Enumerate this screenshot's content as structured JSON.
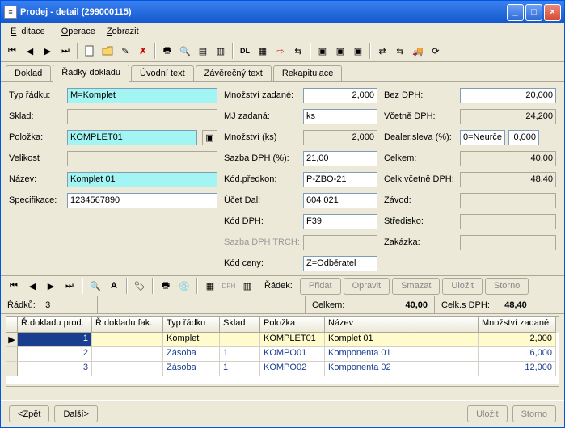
{
  "title": "Prodej - detail (299000115)",
  "menu": {
    "edit": "Editace",
    "oper": "Operace",
    "view": "Zobrazit"
  },
  "tabs": {
    "t1": "Doklad",
    "t2": "Řádky dokladu",
    "t3": "Úvodní text",
    "t4": "Závěrečný text",
    "t5": "Rekapitulace"
  },
  "f": {
    "typ_l": "Typ řádku:",
    "typ_v": "M=Komplet",
    "sklad_l": "Sklad:",
    "sklad_v": "",
    "pol_l": "Položka:",
    "pol_v": "KOMPLET01",
    "vel_l": "Velikost",
    "vel_v": "",
    "naz_l": "Název:",
    "naz_v": "Komplet 01",
    "spec_l": "Specifikace:",
    "spec_v": "1234567890",
    "mnz_l": "Množství zadané:",
    "mnz_v": "2,000",
    "mjz_l": "MJ zadaná:",
    "mjz_v": "ks",
    "mnk_l": "Množství (ks)",
    "mnk_v": "2,000",
    "sdp_l": "Sazba DPH (%):",
    "sdp_v": "21,00",
    "kpk_l": "Kód.předkon:",
    "kpk_v": "P-ZBO-21",
    "ucd_l": "Účet Dal:",
    "ucd_v": "604 021",
    "kdp_l": "Kód DPH:",
    "kdp_v": "F39",
    "str_l": "Sazba DPH TRCH:",
    "str_v": "",
    "kce_l": "Kód ceny:",
    "kce_v": "Z=Odběratel",
    "bdp_l": "Bez DPH:",
    "bdp_v": "20,000",
    "vdp_l": "Včetně DPH:",
    "vdp_v": "24,200",
    "dsl_l": "Dealer.sleva (%):",
    "dsl_a": "0=Neurče",
    "dsl_b": "0,000",
    "clk_l": "Celkem:",
    "clk_v": "40,00",
    "cvd_l": "Celk.včetně DPH:",
    "cvd_v": "48,40",
    "zav_l": "Závod:",
    "zav_v": "",
    "std_l": "Středisko:",
    "std_v": "",
    "zak_l": "Zakázka:",
    "zak_v": ""
  },
  "tb2": {
    "radek": "Řádek:",
    "pridat": "Přidat",
    "opravit": "Opravit",
    "smazat": "Smazat",
    "ulozit": "Uložit",
    "storno": "Storno"
  },
  "status": {
    "radku_l": "Řádků:",
    "radku_v": "3",
    "celkem_l": "Celkem:",
    "celkem_v": "40,00",
    "cdph_l": "Celk.s DPH:",
    "cdph_v": "48,40"
  },
  "gh": {
    "c1": "Ř.dokladu prod.",
    "c2": "Ř.dokladu fak.",
    "c3": "Typ řádku",
    "c4": "Sklad",
    "c5": "Položka",
    "c6": "Název",
    "c7": "Množství zadané"
  },
  "rows": [
    {
      "rp": "1",
      "rf": "",
      "typ": "Komplet",
      "sk": "",
      "pol": "KOMPLET01",
      "naz": "Komplet 01",
      "mn": "2,000"
    },
    {
      "rp": "2",
      "rf": "",
      "typ": "Zásoba",
      "sk": "1",
      "pol": "KOMPO01",
      "naz": "Komponenta 01",
      "mn": "6,000"
    },
    {
      "rp": "3",
      "rf": "",
      "typ": "Zásoba",
      "sk": "1",
      "pol": "KOMPO02",
      "naz": "Komponenta 02",
      "mn": "12,000"
    }
  ],
  "bottom": {
    "zpet": "Zpět",
    "dalsi": "Další",
    "ulozit": "Uložit",
    "storno": "Storno"
  }
}
